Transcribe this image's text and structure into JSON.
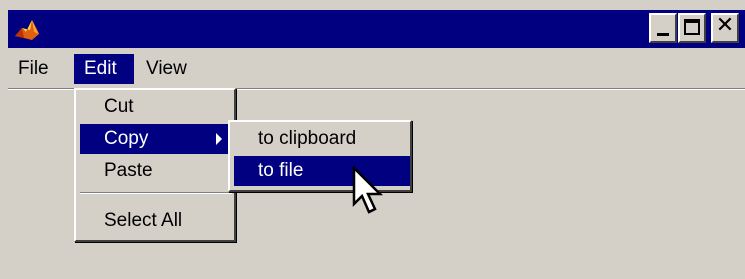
{
  "menubar": {
    "file_label": "File",
    "edit_label": "Edit",
    "view_label": "View"
  },
  "edit_menu": {
    "items": [
      {
        "label": "Cut"
      },
      {
        "label": "Copy",
        "has_submenu": true,
        "selected": true
      },
      {
        "label": "Paste"
      },
      {
        "label": "Select All"
      }
    ]
  },
  "copy_submenu": {
    "items": [
      {
        "label": "to clipboard"
      },
      {
        "label": "to file",
        "selected": true
      }
    ]
  },
  "icons": {
    "app": "app-logo-icon",
    "minimize": "minimize-icon",
    "maximize": "maximize-icon",
    "close": "close-icon",
    "submenu": "chevron-right-icon",
    "cursor": "mouse-pointer-icon"
  },
  "colors": {
    "title_bar": "#000080",
    "window_face": "#d4d0c8",
    "selection": "#000080",
    "selection_text": "#ffffff"
  }
}
